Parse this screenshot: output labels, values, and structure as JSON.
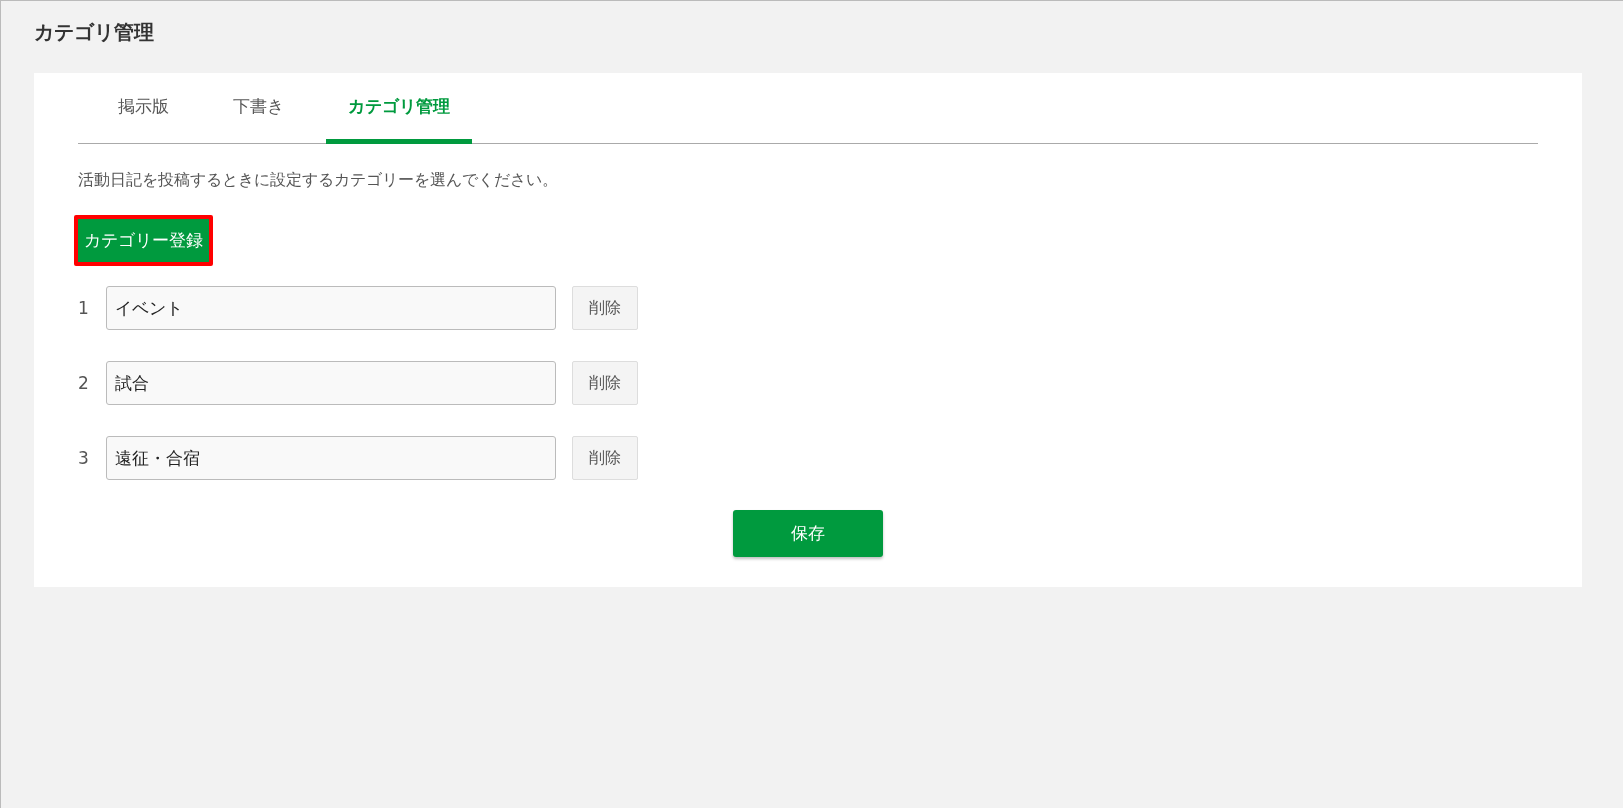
{
  "page_title": "カテゴリ管理",
  "tabs": [
    {
      "label": "掲示版",
      "selected": false
    },
    {
      "label": "下書き",
      "selected": false
    },
    {
      "label": "カテゴリ管理",
      "selected": true
    }
  ],
  "description": "活動日記を投稿するときに設定するカテゴリーを選んでください。",
  "register_button": {
    "label": "カテゴリー登録",
    "highlighted": true
  },
  "categories": [
    {
      "number": "1",
      "value": "イベント",
      "delete_label": "削除"
    },
    {
      "number": "2",
      "value": "試合",
      "delete_label": "削除"
    },
    {
      "number": "3",
      "value": "遠征・合宿",
      "delete_label": "削除"
    }
  ],
  "save_button": "保存"
}
